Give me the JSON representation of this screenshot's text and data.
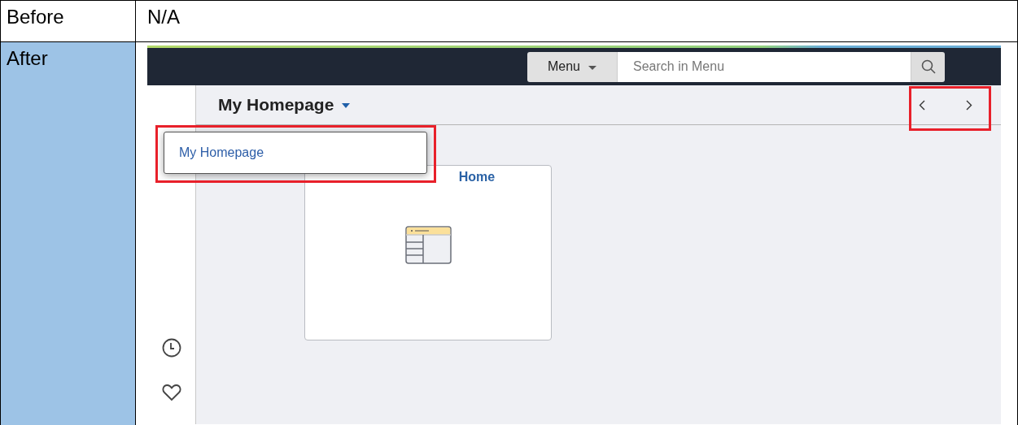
{
  "table": {
    "rows": [
      {
        "label": "Before",
        "kind": "text",
        "value": "N/A"
      },
      {
        "label": "After",
        "kind": "screenshot"
      }
    ]
  },
  "app": {
    "menu_button": "Menu",
    "search": {
      "placeholder": "Search in Menu"
    },
    "page_title": "My Homepage",
    "dropdown": {
      "expanded": true,
      "items": [
        {
          "label": "My Homepage"
        }
      ]
    },
    "tiles": [
      {
        "title": "Home"
      }
    ]
  }
}
